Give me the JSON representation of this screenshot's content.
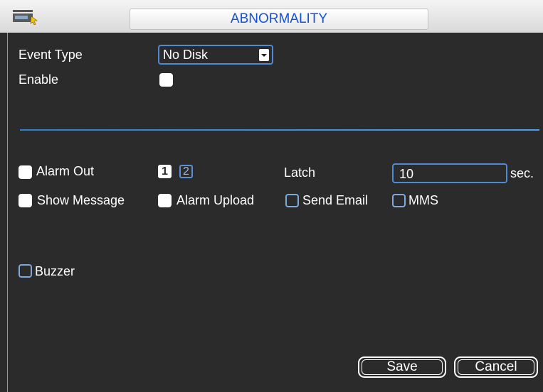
{
  "window": {
    "title": "ABNORMALITY",
    "logo_icon": "device-logo-icon"
  },
  "form": {
    "event_type_label": "Event Type",
    "event_type_value": "No Disk",
    "enable_label": "Enable",
    "enable_checked": true
  },
  "actions": {
    "alarm_out_label": "Alarm Out",
    "alarm_out_checked": true,
    "channels": [
      "1",
      "2"
    ],
    "latch_label": "Latch",
    "latch_value": "10",
    "latch_unit": "sec.",
    "show_message_label": "Show Message",
    "show_message_checked": true,
    "alarm_upload_label": "Alarm Upload",
    "alarm_upload_checked": true,
    "send_email_label": "Send Email",
    "send_email_checked": false,
    "mms_label": "MMS",
    "mms_checked": false,
    "buzzer_label": "Buzzer",
    "buzzer_checked": false
  },
  "buttons": {
    "save": "Save",
    "cancel": "Cancel"
  },
  "colors": {
    "background": "#2b2b2b",
    "accent": "#4f8ad4",
    "title_text": "#1450d8"
  }
}
